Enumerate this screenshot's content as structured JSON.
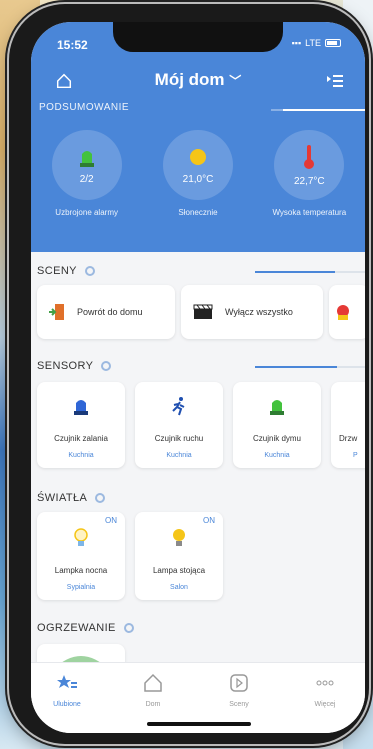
{
  "status": {
    "time": "15:52",
    "network": "LTE"
  },
  "header": {
    "title": "Mój dom"
  },
  "summary": {
    "label": "PODSUMOWANIE",
    "items": [
      {
        "value": "2/2",
        "caption": "Uzbrojone alarmy",
        "icon": "siren-icon"
      },
      {
        "value": "21,0°C",
        "caption": "Słonecznie",
        "icon": "sun-icon"
      },
      {
        "value": "22,7°C",
        "caption": "Wysoka temperatura",
        "icon": "thermometer-icon"
      }
    ]
  },
  "scenes": {
    "label": "SCENY",
    "items": [
      {
        "label": "Powrót do domu",
        "icon": "door-icon"
      },
      {
        "label": "Wyłącz wszystko",
        "icon": "clapperboard-icon"
      }
    ]
  },
  "sensors": {
    "label": "SENSORY",
    "items": [
      {
        "name": "Czujnik zalania",
        "room": "Kuchnia",
        "icon": "siren-blue-icon"
      },
      {
        "name": "Czujnik ruchu",
        "room": "Kuchnia",
        "icon": "running-person-icon"
      },
      {
        "name": "Czujnik dymu",
        "room": "Kuchnia",
        "icon": "siren-green-icon"
      },
      {
        "name": "Drzw",
        "room": "P",
        "icon": ""
      }
    ]
  },
  "lights": {
    "label": "ŚWIATŁA",
    "items": [
      {
        "name": "Lampka nocna",
        "room": "Sypialnia",
        "state": "ON",
        "icon": "bulb-icon"
      },
      {
        "name": "Lampa stojąca",
        "room": "Salon",
        "state": "ON",
        "icon": "bulb-on-icon"
      }
    ]
  },
  "heating": {
    "label": "OGRZEWANIE"
  },
  "tabs": [
    {
      "label": "Ulubione",
      "icon": "star-list-icon",
      "active": true
    },
    {
      "label": "Dom",
      "icon": "house-icon",
      "active": false
    },
    {
      "label": "Sceny",
      "icon": "scene-icon",
      "active": false
    },
    {
      "label": "Więcej",
      "icon": "more-icon",
      "active": false
    }
  ],
  "colors": {
    "accent": "#4a86d8",
    "background": "#f4f5f7"
  }
}
